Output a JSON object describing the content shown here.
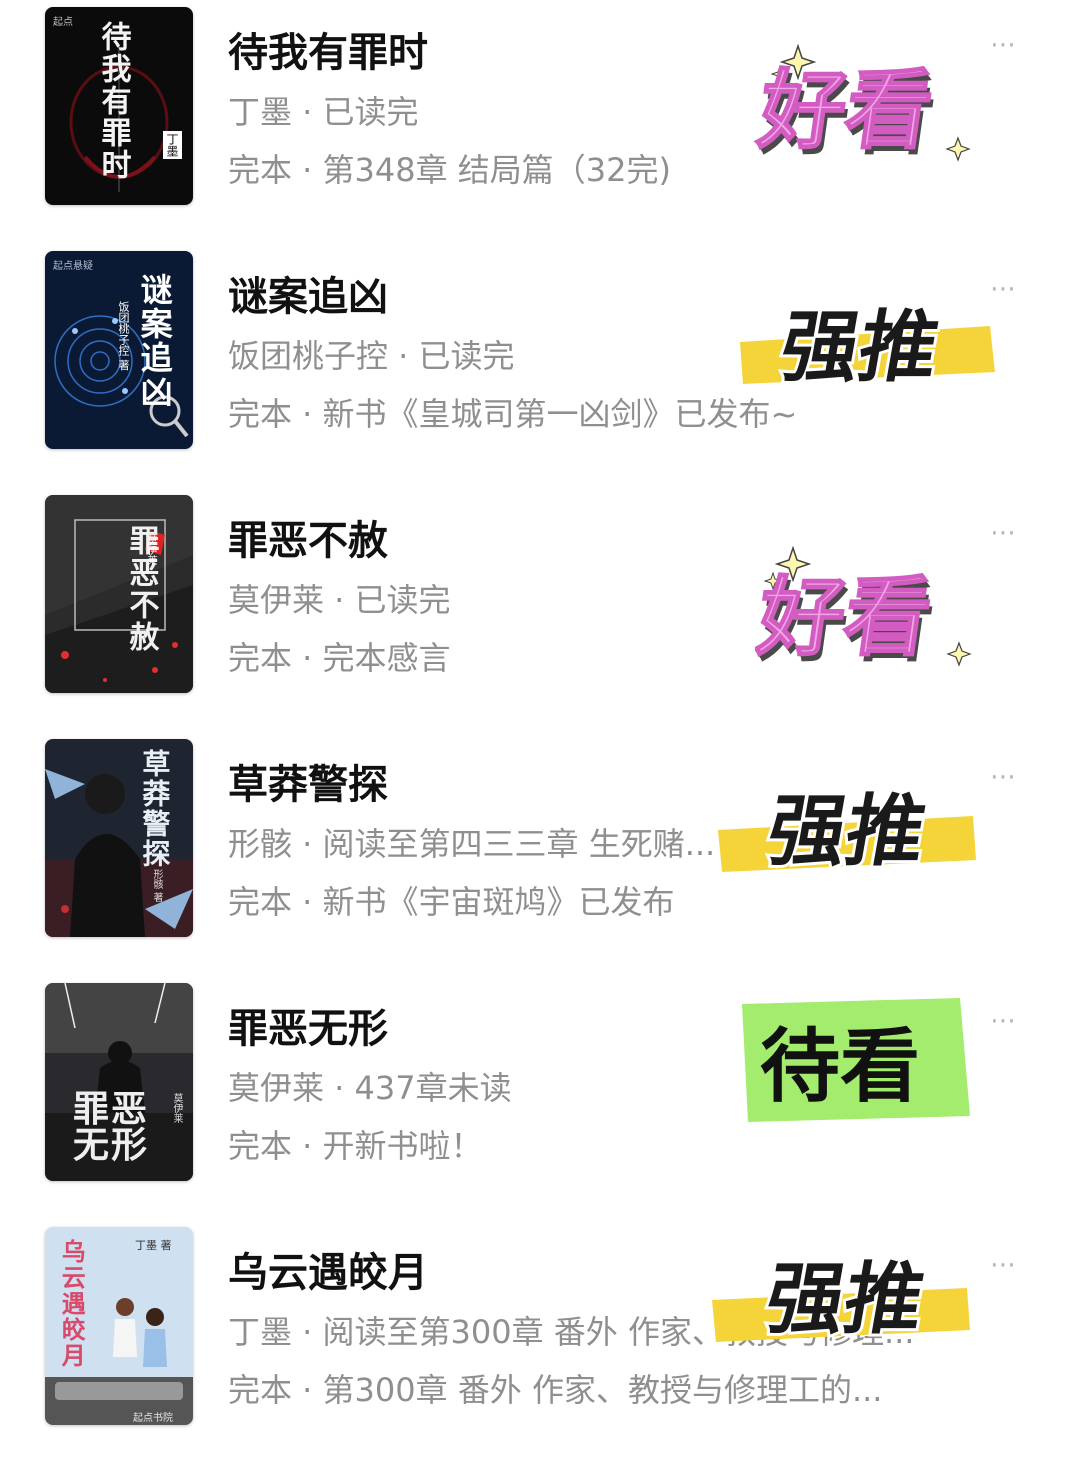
{
  "books": [
    {
      "title": "待我有罪时",
      "line2": "丁墨 · 已读完",
      "line3": "完本 · 第348章 结局篇（32完)",
      "sticker": "好看",
      "sticker_style": "pink",
      "cover": {
        "title_text": "待我有罪时",
        "author_text": "丁墨",
        "publisher_text": "起点",
        "bg": "#0b0b0b",
        "accent": "#b0101a"
      }
    },
    {
      "title": "谜案追凶",
      "line2": "饭团桃子控 · 已读完",
      "line3": "完本 · 新书《皇城司第一凶剑》已发布~",
      "sticker": "强推",
      "sticker_style": "yellow",
      "cover": {
        "title_text": "谜案追凶",
        "author_text": "饭团桃子控 著",
        "publisher_text": "起点悬疑",
        "bg": "#0a1a35",
        "accent": "#3a7bd5"
      }
    },
    {
      "title": "罪恶不赦",
      "line2": "莫伊莱 · 已读完",
      "line3": "完本 · 完本感言",
      "sticker": "好看",
      "sticker_style": "pink",
      "cover": {
        "title_text": "罪恶不赦",
        "author_text": "莫伊莱",
        "publisher_text": "",
        "bg": "#2b2b2b",
        "accent": "#e03030"
      }
    },
    {
      "title": "草莽警探",
      "line2": "形骸 · 阅读至第四三三章 生死赌...",
      "line3": "完本 · 新书《宇宙斑鸠》已发布",
      "sticker": "强推",
      "sticker_style": "yellow",
      "cover": {
        "title_text": "草莽警探",
        "author_text": "形骸 著",
        "publisher_text": "",
        "bg": "#1e2530",
        "accent": "#c9d6e3"
      }
    },
    {
      "title": "罪恶无形",
      "line2": "莫伊莱 · 437章未读",
      "line3": "完本 · 开新书啦！",
      "sticker": "待看",
      "sticker_style": "green",
      "cover": {
        "title_text": "罪恶无形",
        "author_text": "莫伊莱",
        "publisher_text": "",
        "bg": "#2a2a2e",
        "accent": "#d9d9d9"
      }
    },
    {
      "title": "乌云遇皎月",
      "line2": "丁墨 · 阅读至第300章 番外 作家、教授与修理...",
      "line3": "完本 · 第300章 番外 作家、教授与修理工的...",
      "sticker": "强推",
      "sticker_style": "yellow",
      "cover": {
        "title_text": "乌云遇皎月",
        "author_text": "丁墨 著",
        "publisher_text": "起点书院",
        "bg": "#d7e4f2",
        "accent": "#d74a6a"
      }
    }
  ],
  "more_icon": "⋯"
}
